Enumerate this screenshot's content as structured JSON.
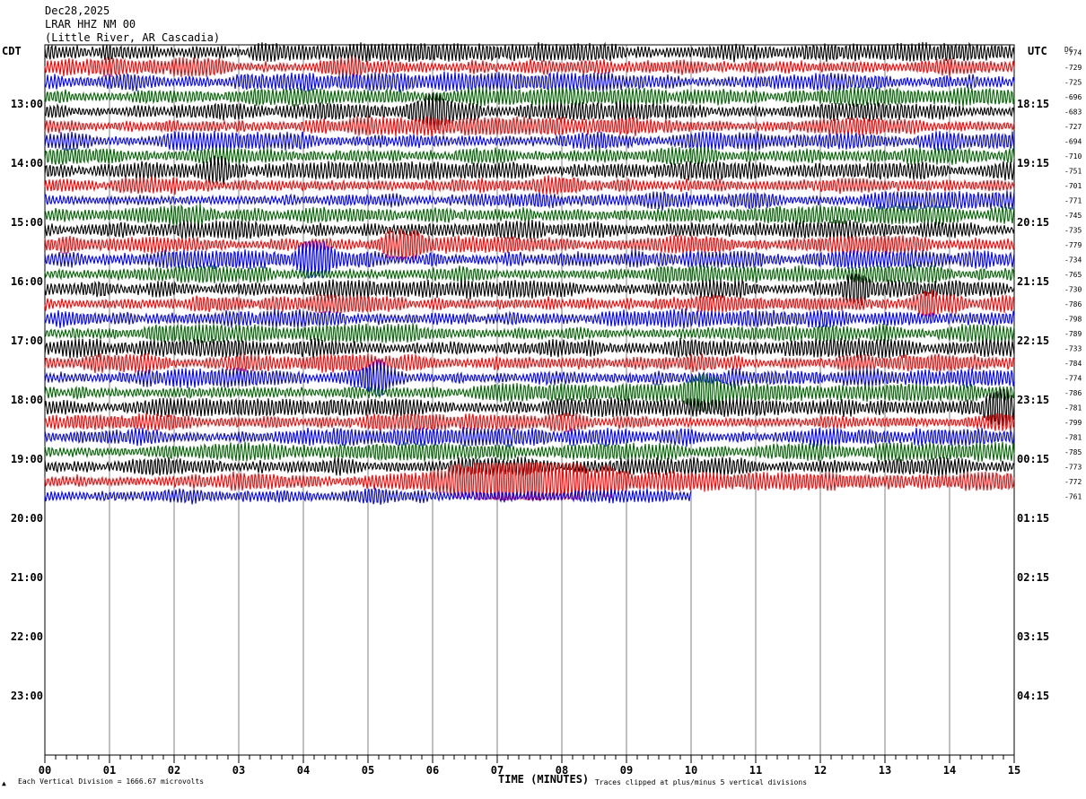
{
  "header": {
    "date": "Dec28,2025",
    "station": "LRAR HHZ NM 00",
    "location": "(Little River, AR Cascadia)",
    "left_tz": "CDT",
    "right_tz": "UTC",
    "dc_label": "DC"
  },
  "footer": {
    "scale_note": "Each Vertical Division = 1666.67 microvolts",
    "clip_note": "Traces clipped at plus/minus 5 vertical divisions",
    "xlabel": "TIME (MINUTES)"
  },
  "chart_data": {
    "type": "line",
    "title": "LRAR HHZ NM 00",
    "xlabel": "TIME (MINUTES)",
    "xlim": [
      0,
      15
    ],
    "x_ticks": [
      "00",
      "01",
      "02",
      "03",
      "04",
      "05",
      "06",
      "07",
      "08",
      "09",
      "10",
      "11",
      "12",
      "13",
      "14",
      "15"
    ],
    "rows_per_hour": 4,
    "hours": 12,
    "left_labels": [
      "13:00",
      "14:00",
      "15:00",
      "16:00",
      "17:00",
      "18:00",
      "19:00",
      "20:00",
      "21:00",
      "22:00",
      "23:00"
    ],
    "right_labels": [
      "18:15",
      "19:15",
      "20:15",
      "21:15",
      "22:15",
      "23:15",
      "00:15",
      "01:15",
      "02:15",
      "03:15",
      "04:15"
    ],
    "trace_colors": [
      "#000000",
      "#ff0000",
      "#0000ff",
      "#006400"
    ],
    "dc_offsets": [
      -774,
      -729,
      -725,
      -696,
      -683,
      -727,
      -694,
      -710,
      -751,
      -701,
      -771,
      -745,
      -735,
      -779,
      -734,
      -765,
      -730,
      -786,
      -798,
      -789,
      -733,
      -784,
      -774,
      -786,
      -781,
      -799,
      -781,
      -785,
      -773,
      -772,
      -761
    ],
    "last_trace_end_minute": 10,
    "events": [
      {
        "trace": 1,
        "minute": 4.6,
        "amp": 1.6
      },
      {
        "trace": 4,
        "minute": 6.0,
        "amp": 1.4
      },
      {
        "trace": 8,
        "minute": 2.6,
        "amp": 1.5
      },
      {
        "trace": 11,
        "minute": 2.3,
        "amp": 2.0
      },
      {
        "trace": 13,
        "minute": 5.5,
        "amp": 1.7
      },
      {
        "trace": 14,
        "minute": 4.2,
        "amp": 1.5
      },
      {
        "trace": 16,
        "minute": 12.5,
        "amp": 1.4
      },
      {
        "trace": 17,
        "minute": 13.7,
        "amp": 1.5
      },
      {
        "trace": 22,
        "minute": 5.1,
        "amp": 1.3
      },
      {
        "trace": 23,
        "minute": 10.15,
        "amp": 2.4
      },
      {
        "trace": 24,
        "minute": 14.8,
        "amp": 1.6
      },
      {
        "trace": 29,
        "minute": 7.6,
        "amp": 2.6
      }
    ]
  }
}
